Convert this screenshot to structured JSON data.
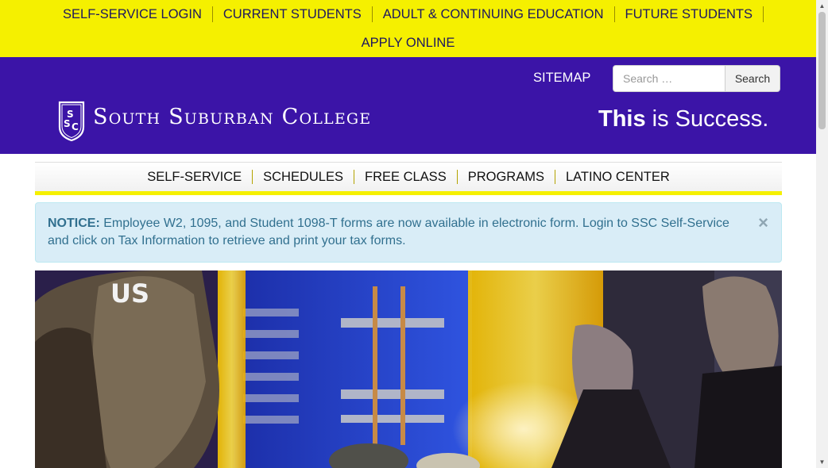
{
  "top_nav": {
    "items": [
      {
        "label": "SELF-SERVICE LOGIN"
      },
      {
        "label": "CURRENT STUDENTS"
      },
      {
        "label": "ADULT & CONTINUING EDUCATION"
      },
      {
        "label": "FUTURE STUDENTS"
      },
      {
        "label": "APPLY ONLINE"
      }
    ]
  },
  "header": {
    "sitemap_label": "SITEMAP",
    "search": {
      "placeholder": "Search …",
      "button_label": "Search"
    },
    "logo": {
      "text": "South Suburban College",
      "emblem_letters": "SSC"
    },
    "tagline": {
      "bold": "This",
      "rest": " is Success."
    }
  },
  "main_nav": {
    "items": [
      {
        "label": "SELF-SERVICE"
      },
      {
        "label": "SCHEDULES"
      },
      {
        "label": "FREE CLASS"
      },
      {
        "label": "PROGRAMS"
      },
      {
        "label": "LATINO CENTER"
      }
    ]
  },
  "notice": {
    "label": "NOTICE:",
    "text": " Employee W2, 1095, and Student 1098-T forms are now available in electronic form. Login to SSC Self-Service and click on Tax Information to retrieve and print your tax forms.",
    "close_symbol": "×"
  },
  "colors": {
    "top_bar": "#f5f000",
    "header": "#3b14a7",
    "notice_bg": "#d9edf7",
    "notice_text": "#31708f"
  }
}
